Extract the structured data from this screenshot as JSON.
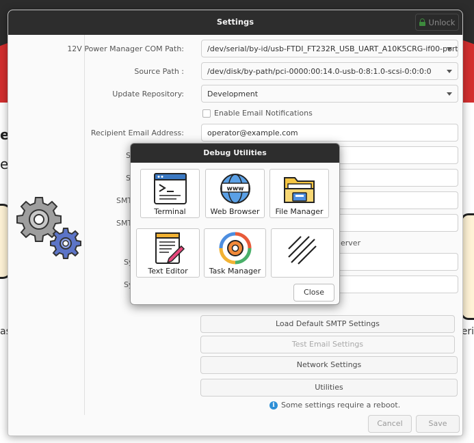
{
  "background": {
    "left_text_1": "el",
    "left_text_2": "ec",
    "left_bottom": "as",
    "right_bottom": "eri"
  },
  "window": {
    "title": "Settings",
    "unlock_label": "Unlock"
  },
  "form": {
    "com_path_label": "12V Power Manager COM Path:",
    "com_path_value": "/dev/serial/by-id/usb-FTDI_FT232R_USB_UART_A10K5CRG-if00-port0",
    "source_path_label": "Source Path :",
    "source_path_value": "/dev/disk/by-path/pci-0000:00:14.0-usb-0:8:1.0-scsi-0:0:0:0",
    "update_repo_label": "Update Repository:",
    "update_repo_value": "Development",
    "email_notifications_label": "Enable Email Notifications",
    "recipient_label": "Recipient Email Address:",
    "recipient_value": "operator@example.com",
    "peek_s1": "S",
    "peek_s2": "S",
    "peek_smt1": "SMT",
    "peek_smt2": "SMT",
    "peek_server": "erver",
    "peek_sy1": "Sy",
    "peek_sy2": "Sy"
  },
  "buttons": {
    "load_default_smtp": "Load Default SMTP Settings",
    "test_email": "Test Email Settings",
    "network_settings": "Network Settings",
    "utilities": "Utilities",
    "cancel": "Cancel",
    "save": "Save"
  },
  "info": {
    "reboot_notice": "Some settings require a reboot."
  },
  "dialog": {
    "title": "Debug Utilities",
    "tiles": [
      {
        "label": "Terminal",
        "icon": "terminal-icon"
      },
      {
        "label": "Web Browser",
        "icon": "web-browser-icon"
      },
      {
        "label": "File Manager",
        "icon": "folder-icon"
      },
      {
        "label": "Text Editor",
        "icon": "text-editor-icon"
      },
      {
        "label": "Task Manager",
        "icon": "task-manager-icon"
      },
      {
        "label": "",
        "icon": "placeholder-hatch-icon"
      }
    ],
    "close_label": "Close"
  },
  "colors": {
    "titlebar": "#2d2d2d",
    "accent_red": "#d32f2f",
    "info_blue": "#2d8fd6",
    "lock_green": "#3d8a3d"
  }
}
